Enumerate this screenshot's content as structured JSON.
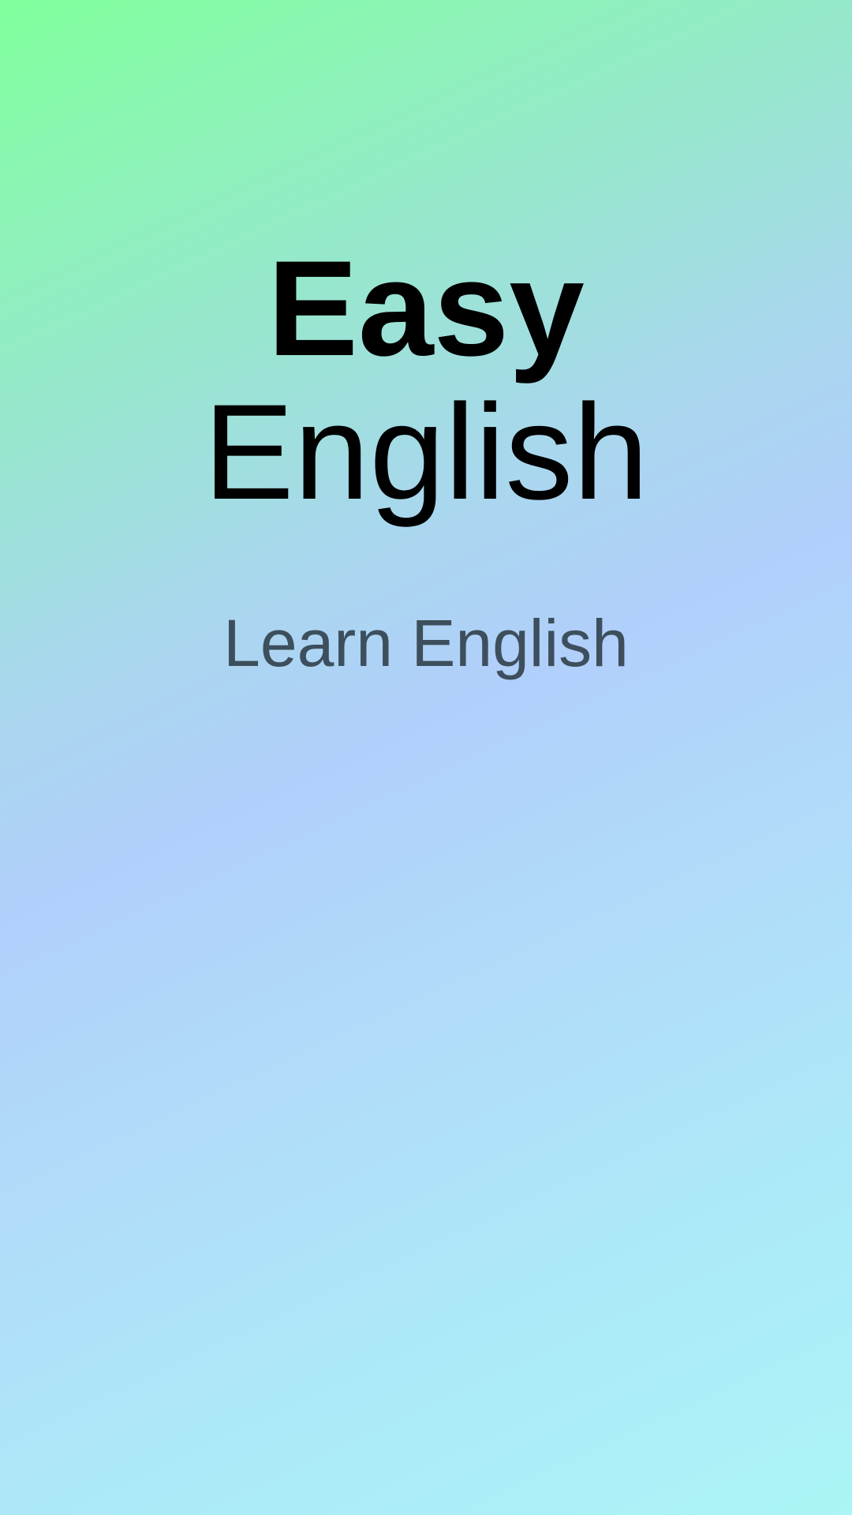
{
  "splash": {
    "title_line_1": "Easy",
    "title_line_2": "English",
    "subtitle": "Learn English"
  },
  "colors": {
    "gradient_start": "#80ff9c",
    "gradient_mid": "#b1cffb",
    "gradient_end": "#abf5f6",
    "title_text": "#000000",
    "subtitle_text": "#3d4f5c"
  }
}
